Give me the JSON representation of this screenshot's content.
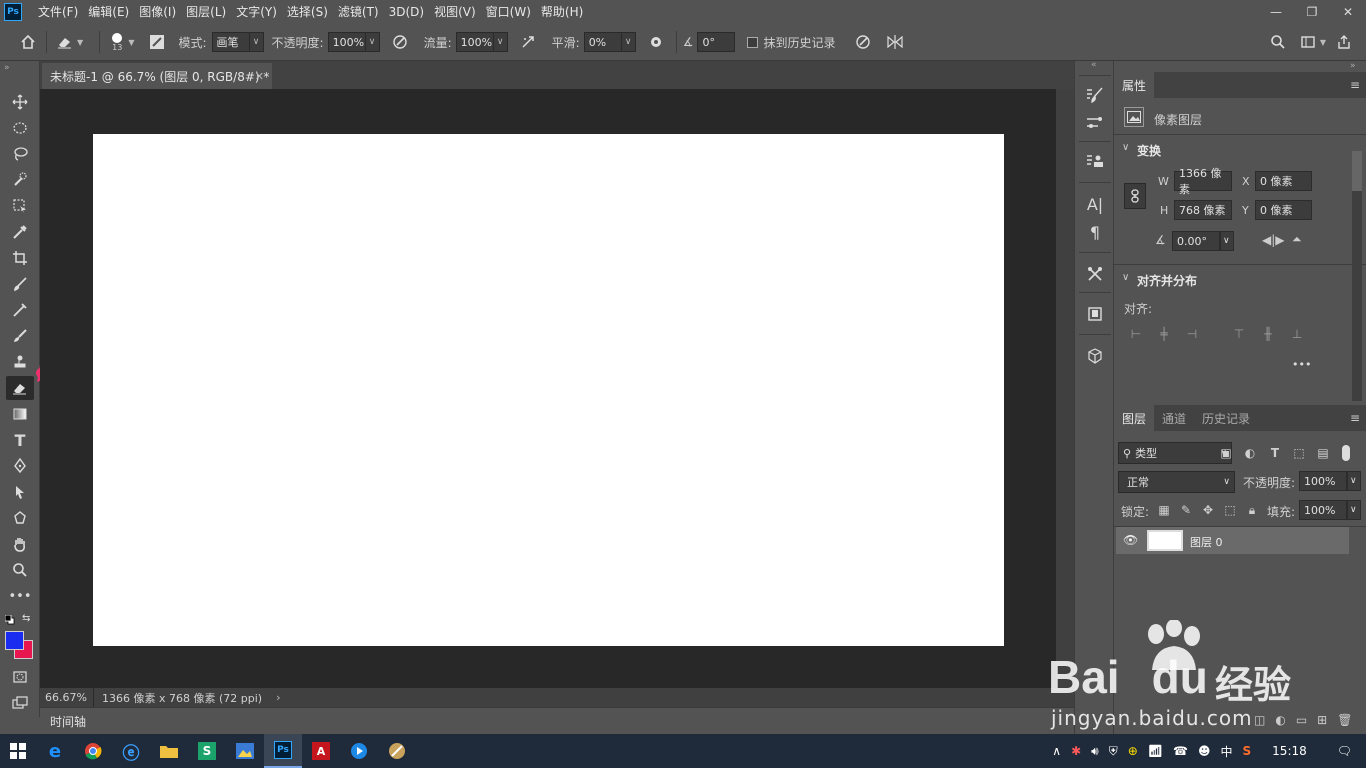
{
  "app": {
    "logo": "Ps"
  },
  "menu": [
    "文件(F)",
    "编辑(E)",
    "图像(I)",
    "图层(L)",
    "文字(Y)",
    "选择(S)",
    "滤镜(T)",
    "3D(D)",
    "视图(V)",
    "窗口(W)",
    "帮助(H)"
  ],
  "window_controls": {
    "minimize": "—",
    "restore": "❐",
    "close": "✕"
  },
  "options": {
    "brush_size": "13",
    "mode_label": "模式:",
    "mode_value": "画笔",
    "opacity_label": "不透明度:",
    "opacity_value": "100%",
    "flow_label": "流量:",
    "flow_value": "100%",
    "smooth_label": "平滑:",
    "smooth_value": "0%",
    "angle_value": "0°",
    "erase_history_label": "抹到历史记录"
  },
  "document": {
    "tab_title": "未标题-1 @ 66.7% (图层 0, RGB/8#) *",
    "zoom": "66.67%",
    "size_info": "1366 像素 x 768 像素 (72 ppi)"
  },
  "timeline_label": "时间轴",
  "properties": {
    "tab": "属性",
    "layer_type": "像素图层",
    "transform_title": "变换",
    "w_label": "W",
    "w_value": "1366 像素",
    "h_label": "H",
    "h_value": "768 像素",
    "x_label": "X",
    "x_value": "0 像素",
    "y_label": "Y",
    "y_value": "0 像素",
    "angle_value": "0.00°",
    "align_title": "对齐并分布",
    "align_label": "对齐:",
    "more": "•••"
  },
  "layers_panel": {
    "tabs": [
      "图层",
      "通道",
      "历史记录"
    ],
    "filter_kind": "类型",
    "blend_mode": "正常",
    "opacity_label": "不透明度:",
    "opacity_value": "100%",
    "lock_label": "锁定:",
    "fill_label": "填充:",
    "fill_value": "100%",
    "layers": [
      {
        "name": "图层 0"
      }
    ]
  },
  "taskbar": {
    "time": "15:18",
    "ime": "中"
  },
  "watermark": {
    "brand": "Bai",
    "brand2": "du",
    "cn": "经验",
    "url": "jingyan.baidu.com"
  },
  "colors": {
    "foreground": "#1a2cf0",
    "background": "#e8164f",
    "annotation_arrow": "#f0306e"
  }
}
